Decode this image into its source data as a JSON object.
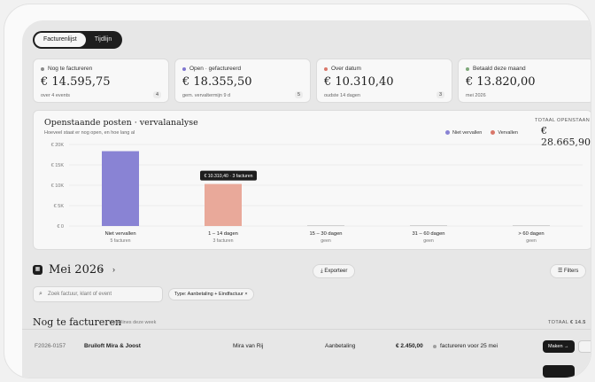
{
  "view_toggle": {
    "active": "Facturenlijst",
    "other": "Tijdlijn"
  },
  "kpis": [
    {
      "label": "Nog te factureren",
      "value": "€ 14.595,75",
      "sub": "over 4 events",
      "count": "4",
      "color": "#8a8a8a"
    },
    {
      "label": "Open · gefactureerd",
      "value": "€ 18.355,50",
      "sub": "gem. vervaltermijn 9 d",
      "count": "5",
      "color": "#7f76cf"
    },
    {
      "label": "Over datum",
      "value": "€ 10.310,40",
      "sub": "oudste 14 dagen",
      "count": "3",
      "color": "#d9776a"
    },
    {
      "label": "Betaald deze maand",
      "value": "€ 13.820,00",
      "sub": "mei 2026",
      "count": "",
      "color": "#7da879"
    }
  ],
  "aging": {
    "title": "Openstaande posten · vervalanalyse",
    "subtitle": "Hoeveel staat er nog open, en hoe lang al",
    "legend": [
      "Niet vervallen",
      "Vervallen"
    ],
    "total_label": "TOTAAL OPENSTAAN",
    "total_value": "€ 28.665,90",
    "tooltip": "€ 10.310,40 · 3 facturen"
  },
  "chart_data": {
    "type": "bar",
    "categories": [
      "Niet vervallen",
      "1 – 14 dagen",
      "15 – 30 dagen",
      "31 – 60 dagen",
      "> 60 dagen"
    ],
    "category_subs": [
      "5 facturen",
      "3 facturen",
      "geen",
      "geen",
      "geen"
    ],
    "values": [
      18355.5,
      10310.4,
      0,
      0,
      0
    ],
    "bar_colors": [
      "#8983d4",
      "#e9a99a",
      "#d0d0d0",
      "#d0d0d0",
      "#d0d0d0"
    ],
    "ylim": [
      0,
      20000
    ],
    "yticks": [
      0,
      5000,
      10000,
      15000,
      20000
    ],
    "ytick_labels": [
      "€ 0",
      "€ 5K",
      "€ 10K",
      "€ 15K",
      "€ 20K"
    ],
    "grid": true
  },
  "period": {
    "month": "Mei 2026",
    "prev": "‹",
    "next": "›",
    "export": "Exporteer",
    "filters": "Filters",
    "cal_icon": "▦"
  },
  "search": {
    "placeholder": "Zoek factuur, klant of event"
  },
  "filter_chip": "Type: Aanbetaling + Eindfactuur  ×",
  "section": {
    "title": "Nog te factureren",
    "subtitle": "deadlines deze week",
    "total_label": "TOTAAL",
    "total_value": "€ 14.5"
  },
  "rows": [
    {
      "id": "F2026-0157",
      "event": "Bruiloft Mira & Joost",
      "client": "Mira van Rij",
      "type": "Aanbetaling",
      "amount": "€ 2.450,00",
      "status": "factureren voor 25 mei",
      "action": "Maken →"
    }
  ]
}
